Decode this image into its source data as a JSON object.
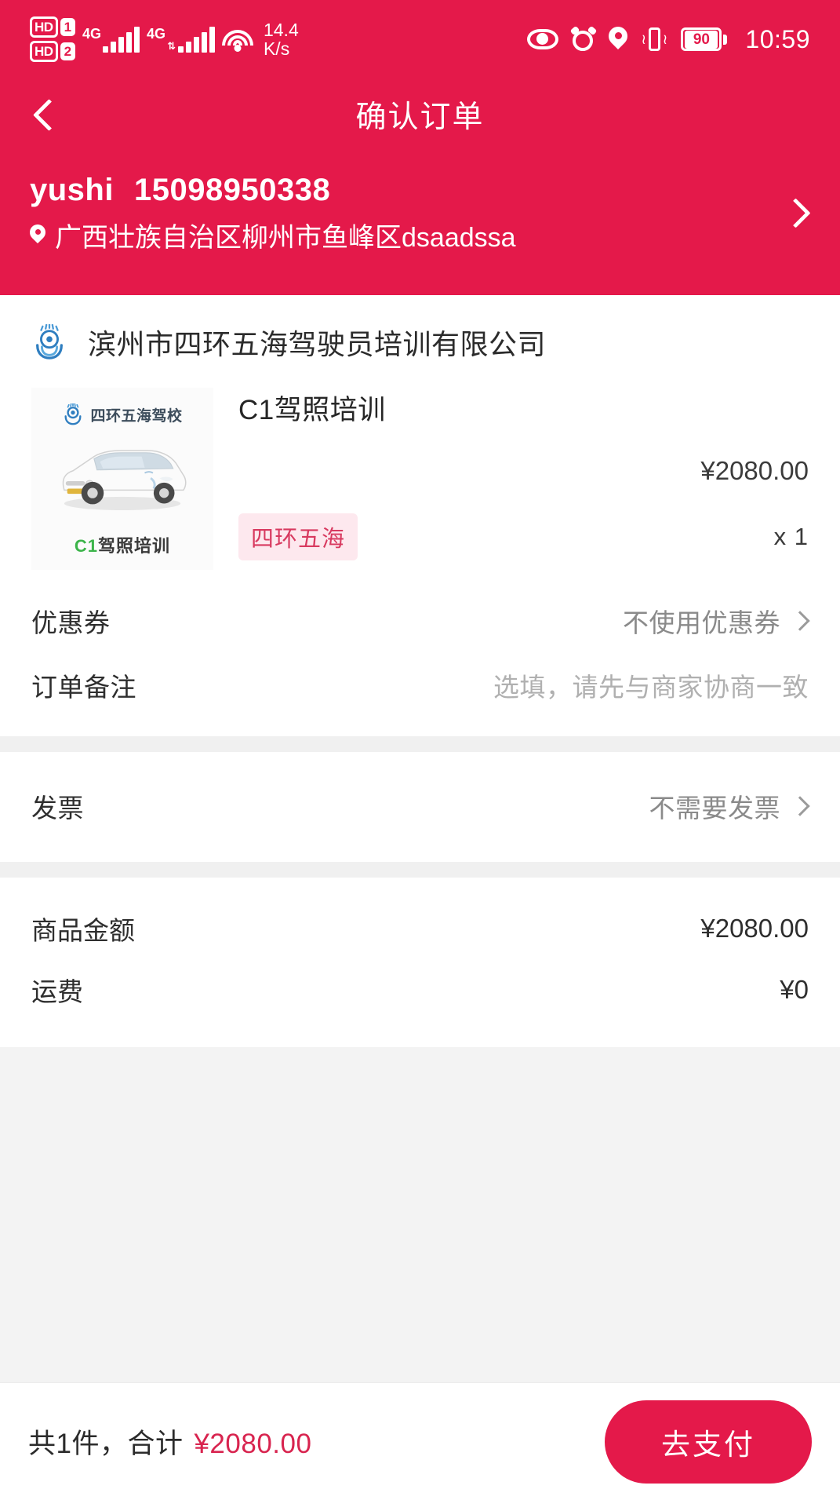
{
  "status_bar": {
    "hd_labels": [
      "HD",
      "HD"
    ],
    "sim_numbers": [
      "1",
      "2"
    ],
    "network_types": [
      "4G",
      "4G"
    ],
    "network_speed_value": "14.4",
    "network_speed_unit": "K/s",
    "battery_percent": "90",
    "time": "10:59",
    "icons": [
      "eye-icon",
      "alarm-icon",
      "location-pin-icon",
      "vibrate-icon",
      "battery-icon"
    ]
  },
  "nav": {
    "back_icon": "chevron-left-icon",
    "title": "确认订单"
  },
  "address": {
    "name": "yushi",
    "phone": "15098950338",
    "detail": "广西壮族自治区柳州市鱼峰区dsaadssa",
    "pin_icon": "location-pin-icon",
    "chevron_icon": "chevron-right-icon"
  },
  "merchant": {
    "logo_icon": "driving-school-logo-icon",
    "name": "滨州市四环五海驾驶员培训有限公司"
  },
  "product": {
    "thumb_brand": "四环五海驾校",
    "thumb_caption_code": "C1",
    "thumb_caption_text": "驾照培训",
    "title": "C1驾照培训",
    "price": "¥2080.00",
    "spec_tag": "四环五海",
    "quantity": "x 1"
  },
  "coupon_row": {
    "label": "优惠券",
    "value": "不使用优惠券"
  },
  "remark_row": {
    "label": "订单备注",
    "placeholder": "选填，请先与商家协商一致"
  },
  "invoice_row": {
    "label": "发票",
    "value": "不需要发票"
  },
  "amounts": [
    {
      "label": "商品金额",
      "value": "¥2080.00"
    },
    {
      "label": "运费",
      "value": "¥0"
    }
  ],
  "bottom": {
    "summary_prefix": "共1件，合计",
    "total": "¥2080.00",
    "pay_label": "去支付"
  },
  "colors": {
    "brand_red": "#e4194a",
    "total_red": "#d8244f",
    "tag_bg": "#fde8ee",
    "tag_text": "#d8395f",
    "page_bg": "#f3f3f3"
  }
}
